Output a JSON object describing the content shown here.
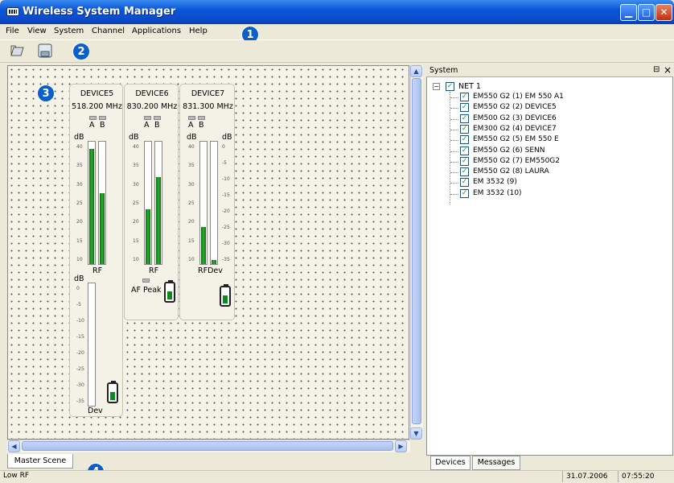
{
  "window": {
    "title": "Wireless System Manager"
  },
  "menu": [
    "File",
    "View",
    "System",
    "Channel",
    "Applications",
    "Help"
  ],
  "callouts": [
    "1",
    "2",
    "3",
    "4"
  ],
  "toolbar": {
    "icons": [
      "open-folder-icon",
      "save-icon"
    ]
  },
  "devices": [
    {
      "name": "DEVICE5",
      "freq": "518.200 MHz",
      "leds": [
        "A",
        "B"
      ],
      "rf_label": "RF",
      "dev_label": "Dev",
      "rf_a": 0.94,
      "rf_b": 0.58,
      "dev_level": 0.0,
      "battery": 0.5
    },
    {
      "name": "DEVICE6",
      "freq": "830.200 MHz",
      "leds": [
        "A",
        "B"
      ],
      "rf_label": "RF",
      "af_label": "AF Peak",
      "rf_a": 0.45,
      "rf_b": 0.71,
      "battery": 0.5
    },
    {
      "name": "DEVICE7",
      "freq": "831.300 MHz",
      "leds": [
        "A",
        "B"
      ],
      "rf_label": "RFDev",
      "rf_a": 0.3,
      "dev_level": 0.03,
      "battery": 0.5
    }
  ],
  "meter_units": "dB",
  "rf_ticks": [
    "40",
    "35",
    "30",
    "25",
    "20",
    "15",
    "10"
  ],
  "dev_ticks": [
    "0",
    "-5",
    "-10",
    "-15",
    "-20",
    "-25",
    "-30",
    "-35"
  ],
  "system_panel": {
    "title": "System",
    "pin": "⊟",
    "close": "×",
    "root": "NET 1",
    "items": [
      "EM550 G2 (1) EM 550 A1",
      "EM550 G2 (2) DEVICE5",
      "EM500 G2 (3) DEVICE6",
      "EM300 G2 (4) DEVICE7",
      "EM550 G2 (5) EM 550 E",
      "EM550 G2 (6) SENN",
      "EM550 G2 (7) EM550G2",
      "EM550 G2 (8) LAURA",
      "EM 3532 (9)",
      "EM 3532 (10)"
    ],
    "tabs": [
      "Devices",
      "Messages"
    ]
  },
  "scene_tab": "Master Scene",
  "status": {
    "left": "Low RF",
    "date": "31.07.2006",
    "time": "07:55:20"
  }
}
